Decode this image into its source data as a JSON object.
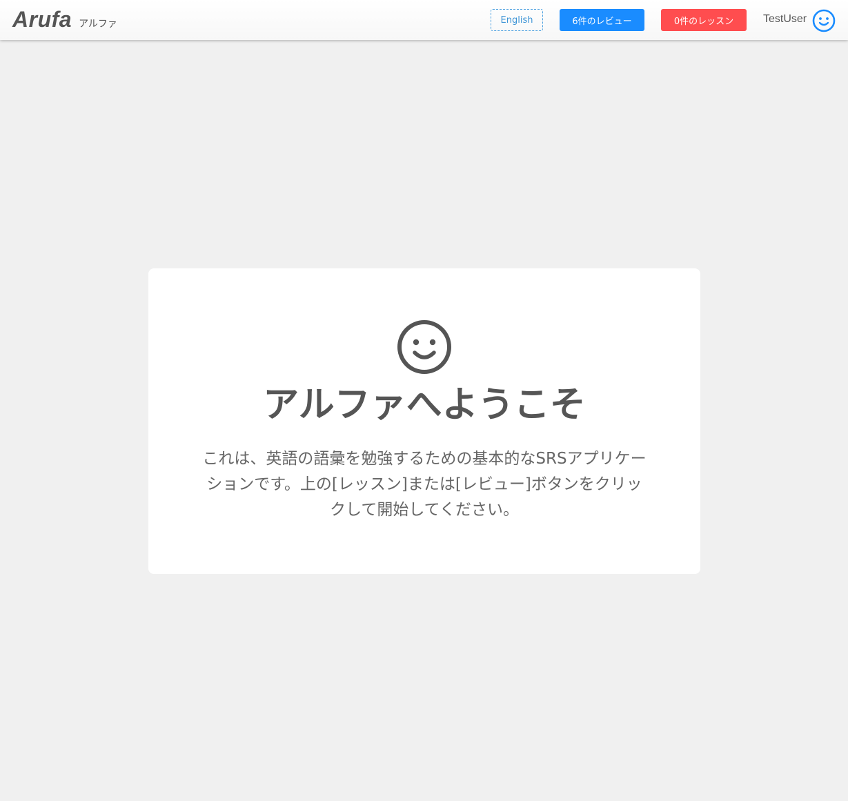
{
  "header": {
    "brand_name": "Arufa",
    "brand_sub": "アルファ",
    "language_button": "English",
    "review_button": "6件のレビュー",
    "lesson_button": "0件のレッスン",
    "user_name": "TestUser",
    "user_icon": "smiley-icon"
  },
  "main": {
    "icon": "smiley-icon",
    "title": "アルファへようこそ",
    "description": "これは、英語の語彙を勉強するための基本的なSRSアプリケーションです。上の[レッスン]または[レビュー]ボタンをクリックして開始してください。"
  },
  "colors": {
    "background": "#f0f0f0",
    "text": "#555555",
    "review_button": "#1a8cff",
    "lesson_button": "#ff4d4f",
    "language_border": "#4a9fe0",
    "user_icon": "#1a8cff"
  }
}
